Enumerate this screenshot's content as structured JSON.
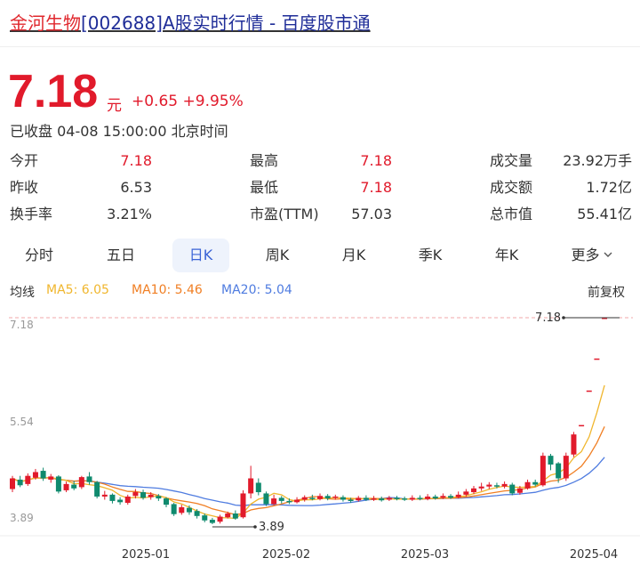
{
  "header": {
    "title_highlight": "金河生物",
    "title_rest": "[002688]A股实时行情 - 百度股市通"
  },
  "quote": {
    "price": "7.18",
    "unit": "元",
    "change": "+0.65",
    "change_pct": "+9.95%",
    "status": "已收盘 04-08 15:00:00 北京时间"
  },
  "stats": [
    {
      "label": "今开",
      "value": "7.18",
      "color": "red"
    },
    {
      "label": "最高",
      "value": "7.18",
      "color": "red"
    },
    {
      "label": "成交量",
      "value": "23.92万手",
      "color": "normal"
    },
    {
      "label": "昨收",
      "value": "6.53",
      "color": "normal"
    },
    {
      "label": "最低",
      "value": "7.18",
      "color": "red"
    },
    {
      "label": "成交额",
      "value": "1.72亿",
      "color": "normal"
    },
    {
      "label": "换手率",
      "value": "3.21%",
      "color": "normal"
    },
    {
      "label": "市盈(TTM)",
      "value": "57.03",
      "color": "normal"
    },
    {
      "label": "总市值",
      "value": "55.41亿",
      "color": "normal"
    }
  ],
  "tabs": [
    {
      "label": "分时",
      "active": false
    },
    {
      "label": "五日",
      "active": false
    },
    {
      "label": "日K",
      "active": true
    },
    {
      "label": "周K",
      "active": false
    },
    {
      "label": "月K",
      "active": false
    },
    {
      "label": "季K",
      "active": false
    },
    {
      "label": "年K",
      "active": false
    },
    {
      "label": "更多",
      "active": false,
      "icon": "chevron-down-icon"
    }
  ],
  "ma_legend": {
    "title": "均线",
    "ma5": "MA5: 6.05",
    "ma10": "MA10: 5.46",
    "ma20": "MA20: 5.04",
    "adjust": "前复权"
  },
  "colors": {
    "up": "#e11a2b",
    "down": "#0f8a6e",
    "ma5": "#f0b62d",
    "ma10": "#f07f24",
    "ma20": "#4f7ce0",
    "tab_active": "#3b64d6"
  },
  "chart_data": {
    "type": "candlestick",
    "y_ticks": [
      "7.18",
      "5.54",
      "3.89"
    ],
    "x_ticks": [
      "2025-01",
      "2025-02",
      "2025-03",
      "2025-04"
    ],
    "ylim": [
      3.89,
      7.18
    ],
    "last_close_label": "7.18",
    "low_marker_label": "3.89",
    "candles": [
      {
        "o": 4.45,
        "c": 4.62,
        "h": 4.66,
        "l": 4.4
      },
      {
        "o": 4.6,
        "c": 4.51,
        "h": 4.66,
        "l": 4.48
      },
      {
        "o": 4.53,
        "c": 4.66,
        "h": 4.7,
        "l": 4.5
      },
      {
        "o": 4.63,
        "c": 4.72,
        "h": 4.77,
        "l": 4.6
      },
      {
        "o": 4.74,
        "c": 4.62,
        "h": 4.79,
        "l": 4.58
      },
      {
        "o": 4.6,
        "c": 4.65,
        "h": 4.69,
        "l": 4.55
      },
      {
        "o": 4.65,
        "c": 4.41,
        "h": 4.67,
        "l": 4.38
      },
      {
        "o": 4.43,
        "c": 4.53,
        "h": 4.57,
        "l": 4.4
      },
      {
        "o": 4.52,
        "c": 4.46,
        "h": 4.58,
        "l": 4.43
      },
      {
        "o": 4.48,
        "c": 4.64,
        "h": 4.66,
        "l": 4.45
      },
      {
        "o": 4.65,
        "c": 4.56,
        "h": 4.72,
        "l": 4.52
      },
      {
        "o": 4.56,
        "c": 4.33,
        "h": 4.58,
        "l": 4.3
      },
      {
        "o": 4.33,
        "c": 4.36,
        "h": 4.42,
        "l": 4.28
      },
      {
        "o": 4.36,
        "c": 4.26,
        "h": 4.38,
        "l": 4.22
      },
      {
        "o": 4.28,
        "c": 4.24,
        "h": 4.32,
        "l": 4.2
      },
      {
        "o": 4.23,
        "c": 4.33,
        "h": 4.36,
        "l": 4.2
      },
      {
        "o": 4.34,
        "c": 4.4,
        "h": 4.45,
        "l": 4.3
      },
      {
        "o": 4.4,
        "c": 4.31,
        "h": 4.44,
        "l": 4.28
      },
      {
        "o": 4.32,
        "c": 4.36,
        "h": 4.4,
        "l": 4.28
      },
      {
        "o": 4.34,
        "c": 4.3,
        "h": 4.37,
        "l": 4.26
      },
      {
        "o": 4.3,
        "c": 4.2,
        "h": 4.32,
        "l": 4.16
      },
      {
        "o": 4.21,
        "c": 4.05,
        "h": 4.23,
        "l": 4.02
      },
      {
        "o": 4.07,
        "c": 4.16,
        "h": 4.2,
        "l": 4.04
      },
      {
        "o": 4.15,
        "c": 4.08,
        "h": 4.19,
        "l": 4.04
      },
      {
        "o": 4.1,
        "c": 4.02,
        "h": 4.13,
        "l": 3.98
      },
      {
        "o": 4.03,
        "c": 3.95,
        "h": 4.06,
        "l": 3.92
      },
      {
        "o": 3.96,
        "c": 3.91,
        "h": 3.99,
        "l": 3.89
      },
      {
        "o": 3.93,
        "c": 4.01,
        "h": 4.04,
        "l": 3.9
      },
      {
        "o": 4.0,
        "c": 4.06,
        "h": 4.09,
        "l": 3.98
      },
      {
        "o": 4.06,
        "c": 3.98,
        "h": 4.11,
        "l": 3.96
      },
      {
        "o": 4.0,
        "c": 4.38,
        "h": 4.43,
        "l": 3.98
      },
      {
        "o": 4.38,
        "c": 4.62,
        "h": 4.82,
        "l": 4.3
      },
      {
        "o": 4.55,
        "c": 4.4,
        "h": 4.62,
        "l": 4.35
      },
      {
        "o": 4.38,
        "c": 4.21,
        "h": 4.41,
        "l": 4.18
      },
      {
        "o": 4.21,
        "c": 4.3,
        "h": 4.36,
        "l": 4.19
      },
      {
        "o": 4.31,
        "c": 4.26,
        "h": 4.34,
        "l": 4.22
      },
      {
        "o": 4.26,
        "c": 4.24,
        "h": 4.3,
        "l": 4.21
      },
      {
        "o": 4.24,
        "c": 4.28,
        "h": 4.32,
        "l": 4.22
      },
      {
        "o": 4.28,
        "c": 4.32,
        "h": 4.35,
        "l": 4.25
      },
      {
        "o": 4.31,
        "c": 4.29,
        "h": 4.36,
        "l": 4.27
      },
      {
        "o": 4.29,
        "c": 4.34,
        "h": 4.38,
        "l": 4.27
      },
      {
        "o": 4.34,
        "c": 4.3,
        "h": 4.37,
        "l": 4.27
      },
      {
        "o": 4.31,
        "c": 4.33,
        "h": 4.36,
        "l": 4.28
      },
      {
        "o": 4.32,
        "c": 4.28,
        "h": 4.35,
        "l": 4.25
      },
      {
        "o": 4.28,
        "c": 4.26,
        "h": 4.31,
        "l": 4.23
      },
      {
        "o": 4.27,
        "c": 4.31,
        "h": 4.34,
        "l": 4.25
      },
      {
        "o": 4.31,
        "c": 4.28,
        "h": 4.35,
        "l": 4.26
      },
      {
        "o": 4.29,
        "c": 4.3,
        "h": 4.34,
        "l": 4.26
      },
      {
        "o": 4.3,
        "c": 4.27,
        "h": 4.33,
        "l": 4.25
      },
      {
        "o": 4.28,
        "c": 4.31,
        "h": 4.34,
        "l": 4.26
      },
      {
        "o": 4.31,
        "c": 4.29,
        "h": 4.34,
        "l": 4.27
      },
      {
        "o": 4.3,
        "c": 4.28,
        "h": 4.33,
        "l": 4.26
      },
      {
        "o": 4.28,
        "c": 4.31,
        "h": 4.35,
        "l": 4.26
      },
      {
        "o": 4.31,
        "c": 4.29,
        "h": 4.35,
        "l": 4.27
      },
      {
        "o": 4.29,
        "c": 4.33,
        "h": 4.37,
        "l": 4.27
      },
      {
        "o": 4.33,
        "c": 4.3,
        "h": 4.36,
        "l": 4.28
      },
      {
        "o": 4.31,
        "c": 4.34,
        "h": 4.38,
        "l": 4.29
      },
      {
        "o": 4.34,
        "c": 4.31,
        "h": 4.37,
        "l": 4.29
      },
      {
        "o": 4.32,
        "c": 4.36,
        "h": 4.41,
        "l": 4.3
      },
      {
        "o": 4.36,
        "c": 4.41,
        "h": 4.45,
        "l": 4.33
      },
      {
        "o": 4.4,
        "c": 4.46,
        "h": 4.5,
        "l": 4.37
      },
      {
        "o": 4.46,
        "c": 4.49,
        "h": 4.55,
        "l": 4.42
      },
      {
        "o": 4.49,
        "c": 4.52,
        "h": 4.56,
        "l": 4.45
      },
      {
        "o": 4.51,
        "c": 4.49,
        "h": 4.55,
        "l": 4.46
      },
      {
        "o": 4.49,
        "c": 4.53,
        "h": 4.57,
        "l": 4.46
      },
      {
        "o": 4.52,
        "c": 4.38,
        "h": 4.55,
        "l": 4.35
      },
      {
        "o": 4.39,
        "c": 4.46,
        "h": 4.5,
        "l": 4.36
      },
      {
        "o": 4.46,
        "c": 4.56,
        "h": 4.6,
        "l": 4.44
      },
      {
        "o": 4.56,
        "c": 4.52,
        "h": 4.6,
        "l": 4.49
      },
      {
        "o": 4.51,
        "c": 4.98,
        "h": 5.03,
        "l": 4.49
      },
      {
        "o": 4.98,
        "c": 4.84,
        "h": 5.01,
        "l": 4.75
      },
      {
        "o": 4.86,
        "c": 4.62,
        "h": 4.88,
        "l": 4.55
      },
      {
        "o": 4.62,
        "c": 4.98,
        "h": 5.03,
        "l": 4.58
      },
      {
        "o": 5.0,
        "c": 5.32,
        "h": 5.36,
        "l": 4.96
      },
      {
        "o": 5.47,
        "c": 5.47,
        "h": 5.47,
        "l": 5.47
      },
      {
        "o": 6.02,
        "c": 6.02,
        "h": 6.02,
        "l": 6.02
      },
      {
        "o": 6.53,
        "c": 6.53,
        "h": 6.53,
        "l": 6.53
      },
      {
        "o": 7.18,
        "c": 7.18,
        "h": 7.18,
        "l": 7.18
      }
    ]
  }
}
